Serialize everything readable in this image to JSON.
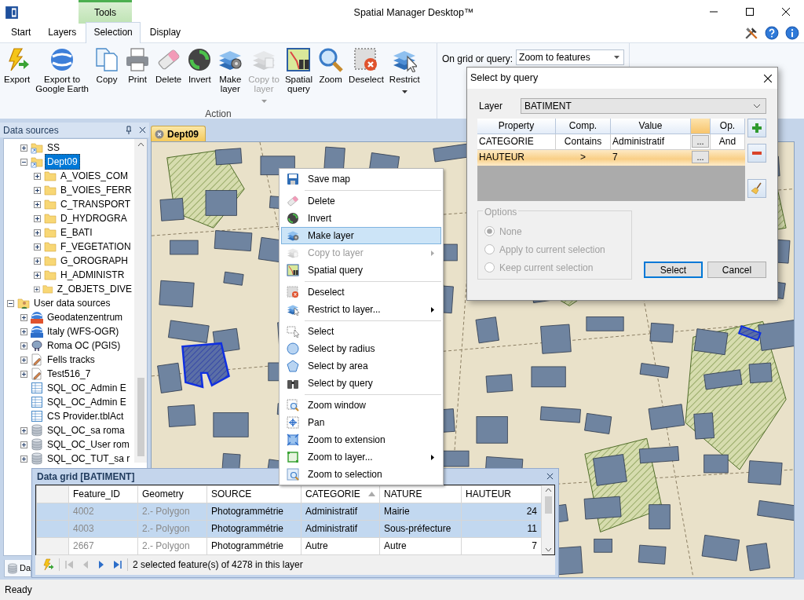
{
  "window": {
    "title": "Spatial Manager Desktop™",
    "contextual_tab": "Tools"
  },
  "ribbon_tabs": [
    {
      "label": "Start",
      "selected": false
    },
    {
      "label": "Layers",
      "selected": false
    },
    {
      "label": "Selection",
      "selected": true
    },
    {
      "label": "Display",
      "selected": false
    }
  ],
  "ribbon": {
    "buttons": [
      {
        "label": "Export",
        "disabled": false,
        "dropdown": false
      },
      {
        "label": "Export to\nGoogle Earth",
        "disabled": false,
        "dropdown": false
      },
      {
        "label": "Copy",
        "disabled": false,
        "dropdown": false
      },
      {
        "label": "Print",
        "disabled": false,
        "dropdown": false
      },
      {
        "label": "Delete",
        "disabled": false,
        "dropdown": false
      },
      {
        "label": "Invert",
        "disabled": false,
        "dropdown": false
      },
      {
        "label": "Make\nlayer",
        "disabled": false,
        "dropdown": false
      },
      {
        "label": "Copy to\nlayer",
        "disabled": true,
        "dropdown": true
      },
      {
        "label": "Spatial\nquery",
        "disabled": false,
        "dropdown": false
      },
      {
        "label": "Zoom",
        "disabled": false,
        "dropdown": false
      },
      {
        "label": "Deselect",
        "disabled": false,
        "dropdown": false
      },
      {
        "label": "Restrict",
        "disabled": false,
        "dropdown": true
      }
    ],
    "group_label": "Action",
    "grid_option": {
      "label": "On grid or query:",
      "value": "Zoom to features"
    }
  },
  "data_sources": {
    "title": "Data sources",
    "bottom_tab": "Da",
    "tree": [
      {
        "children": [
          {
            "label": "SS",
            "kind": "shortcut",
            "expanded": false,
            "selected": false
          },
          {
            "label": "Dept09",
            "kind": "shortcut",
            "expanded": true,
            "selected": true,
            "children": [
              {
                "label": "A_VOIES_COM",
                "kind": "folder",
                "expanded": false,
                "selected": false
              },
              {
                "label": "B_VOIES_FERR",
                "kind": "folder",
                "expanded": false,
                "selected": false
              },
              {
                "label": "C_TRANSPORT",
                "kind": "folder",
                "expanded": false,
                "selected": false
              },
              {
                "label": "D_HYDROGRA",
                "kind": "folder",
                "expanded": false,
                "selected": false
              },
              {
                "label": "E_BATI",
                "kind": "folder",
                "expanded": false,
                "selected": false
              },
              {
                "label": "F_VEGETATION",
                "kind": "folder",
                "expanded": false,
                "selected": false
              },
              {
                "label": "G_OROGRAPH",
                "kind": "folder",
                "expanded": false,
                "selected": false
              },
              {
                "label": "H_ADMINISTR",
                "kind": "folder",
                "expanded": false,
                "selected": false
              },
              {
                "label": "Z_OBJETS_DIVE",
                "kind": "folder",
                "expanded": false,
                "selected": false
              }
            ]
          }
        ]
      },
      {
        "label": "User data sources",
        "kind": "user",
        "expanded": true,
        "selected": false,
        "children": [
          {
            "label": "Geodatenzentrum",
            "kind": "wfs",
            "expanded": false,
            "selected": false
          },
          {
            "label": "Italy (WFS-OGR)",
            "kind": "ogr",
            "expanded": false,
            "selected": false
          },
          {
            "label": "Roma OC (PGIS)",
            "kind": "postgis",
            "expanded": false,
            "selected": false
          },
          {
            "label": "Fells tracks",
            "kind": "file",
            "expanded": false,
            "selected": false
          },
          {
            "label": "Test516_7",
            "kind": "file",
            "expanded": false,
            "selected": false
          },
          {
            "label": "SQL_OC_Admin E",
            "kind": "table",
            "selected": false
          },
          {
            "label": "SQL_OC_Admin E",
            "kind": "table",
            "selected": false
          },
          {
            "label": "CS Provider.tblAct",
            "kind": "table",
            "selected": false
          },
          {
            "label": "SQL_OC_sa roma",
            "kind": "database",
            "expanded": false,
            "selected": false
          },
          {
            "label": "SQL_OC_User rom",
            "kind": "database",
            "expanded": false,
            "selected": false
          },
          {
            "label": "SQL_OC_TUT_sa r",
            "kind": "database",
            "expanded": false,
            "selected": false
          }
        ]
      }
    ]
  },
  "map": {
    "tab": "Dept09"
  },
  "context_menu": [
    {
      "kind": "item",
      "label": "Save map",
      "disabled": false,
      "selected": false,
      "submenu": false
    },
    {
      "kind": "separator"
    },
    {
      "kind": "item",
      "label": "Delete",
      "disabled": false,
      "selected": false,
      "submenu": false
    },
    {
      "kind": "item",
      "label": "Invert",
      "disabled": false,
      "selected": false,
      "submenu": false
    },
    {
      "kind": "item",
      "label": "Make layer",
      "disabled": false,
      "selected": true,
      "submenu": false
    },
    {
      "kind": "item",
      "label": "Copy to layer",
      "disabled": true,
      "selected": false,
      "submenu": true
    },
    {
      "kind": "item",
      "label": "Spatial query",
      "disabled": false,
      "selected": false,
      "submenu": false
    },
    {
      "kind": "separator"
    },
    {
      "kind": "item",
      "label": "Deselect",
      "disabled": false,
      "selected": false,
      "submenu": false
    },
    {
      "kind": "item",
      "label": "Restrict to layer...",
      "disabled": false,
      "selected": false,
      "submenu": true
    },
    {
      "kind": "separator"
    },
    {
      "kind": "item",
      "label": "Select",
      "disabled": false,
      "selected": false,
      "submenu": false
    },
    {
      "kind": "item",
      "label": "Select by radius",
      "disabled": false,
      "selected": false,
      "submenu": false
    },
    {
      "kind": "item",
      "label": "Select by area",
      "disabled": false,
      "selected": false,
      "submenu": false
    },
    {
      "kind": "item",
      "label": "Select by query",
      "disabled": false,
      "selected": false,
      "submenu": false
    },
    {
      "kind": "separator"
    },
    {
      "kind": "item",
      "label": "Zoom window",
      "disabled": false,
      "selected": false,
      "submenu": false
    },
    {
      "kind": "item",
      "label": "Pan",
      "disabled": false,
      "selected": false,
      "submenu": false
    },
    {
      "kind": "item",
      "label": "Zoom to extension",
      "disabled": false,
      "selected": false,
      "submenu": false
    },
    {
      "kind": "item",
      "label": "Zoom to layer...",
      "disabled": false,
      "selected": false,
      "submenu": true
    },
    {
      "kind": "item",
      "label": "Zoom to selection",
      "disabled": false,
      "selected": false,
      "submenu": false
    }
  ],
  "query_dialog": {
    "title": "Select by query",
    "layer_label": "Layer",
    "layer": "BATIMENT",
    "columns": [
      "Property",
      "Comp.",
      "Value",
      "Op."
    ],
    "rows": [
      {
        "property": "CATEGORIE",
        "comparison": "Contains",
        "value": "Administratif",
        "button": "...",
        "operator": "And",
        "selected": false
      },
      {
        "property": "HAUTEUR",
        "comparison": ">",
        "value": "7",
        "button": "...",
        "selected": true
      }
    ],
    "options": {
      "title": "Options",
      "disabled": true,
      "choices": [
        {
          "label": "None",
          "selected": true
        },
        {
          "label": "Apply to current selection",
          "selected": false
        },
        {
          "label": "Keep current selection",
          "selected": false
        }
      ]
    },
    "buttons": [
      {
        "label": "Select",
        "default": true
      },
      {
        "label": "Cancel",
        "default": false
      }
    ]
  },
  "data_grid": {
    "title": "Data grid [BATIMENT]",
    "columns": [
      {
        "label": "Feature_ID",
        "readonly": true,
        "numeric": false
      },
      {
        "label": "Geometry",
        "readonly": true,
        "numeric": false
      },
      {
        "label": "SOURCE",
        "readonly": false,
        "numeric": false
      },
      {
        "label": "CATEGORIE",
        "readonly": false,
        "numeric": false,
        "sorted": true
      },
      {
        "label": "NATURE",
        "readonly": false,
        "numeric": false
      },
      {
        "label": "HAUTEUR",
        "readonly": false,
        "numeric": true
      }
    ],
    "rows": [
      {
        "cells": [
          "4002",
          "2.- Polygon",
          "Photogrammétrie",
          "Administratif",
          "Mairie",
          "24"
        ],
        "selected": true
      },
      {
        "cells": [
          "4003",
          "2.- Polygon",
          "Photogrammétrie",
          "Administratif",
          "Sous-préfecture",
          "11"
        ],
        "selected": true
      },
      {
        "cells": [
          "2667",
          "2.- Polygon",
          "Photogrammétrie",
          "Autre",
          "Autre",
          "7"
        ],
        "selected": false
      }
    ],
    "navigation": [
      {
        "disabled": true
      },
      {
        "disabled": true
      },
      {
        "disabled": false
      },
      {
        "disabled": false
      }
    ],
    "status": "2 selected feature(s) of 4278 in this layer"
  },
  "status_bar": "Ready"
}
